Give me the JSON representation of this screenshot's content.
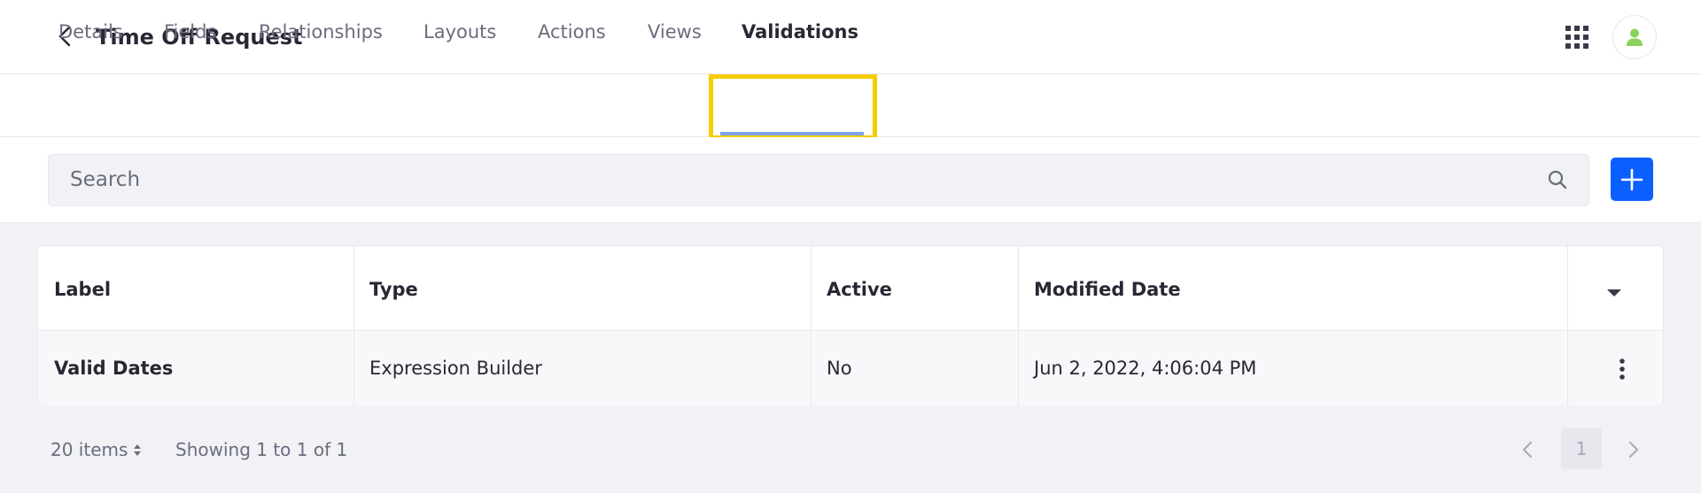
{
  "header": {
    "title": "Time Off Request",
    "back_icon": "chevron-left-icon",
    "apps_icon": "grid-icon",
    "avatar_icon": "user-icon",
    "avatar_color": "#8bd15a"
  },
  "tabs": [
    {
      "label": "Details",
      "active": false
    },
    {
      "label": "Fields",
      "active": false
    },
    {
      "label": "Relationships",
      "active": false
    },
    {
      "label": "Layouts",
      "active": false
    },
    {
      "label": "Actions",
      "active": false
    },
    {
      "label": "Views",
      "active": false
    },
    {
      "label": "Validations",
      "active": true
    }
  ],
  "search": {
    "placeholder": "Search",
    "icon": "search-icon"
  },
  "add_button": {
    "icon": "plus-icon",
    "color": "#0b5fff"
  },
  "table": {
    "columns": [
      "Label",
      "Type",
      "Active",
      "Modified Date"
    ],
    "rows": [
      {
        "label": "Valid Dates",
        "type": "Expression Builder",
        "active": "No",
        "modified": "Jun 2, 2022, 4:06:04 PM"
      }
    ]
  },
  "footer": {
    "items_per_page": "20 items",
    "showing": "Showing 1 to 1 of 1",
    "current_page": "1"
  },
  "colors": {
    "highlight": "#f5cd00",
    "tab_underline": "#7ea4ef"
  }
}
